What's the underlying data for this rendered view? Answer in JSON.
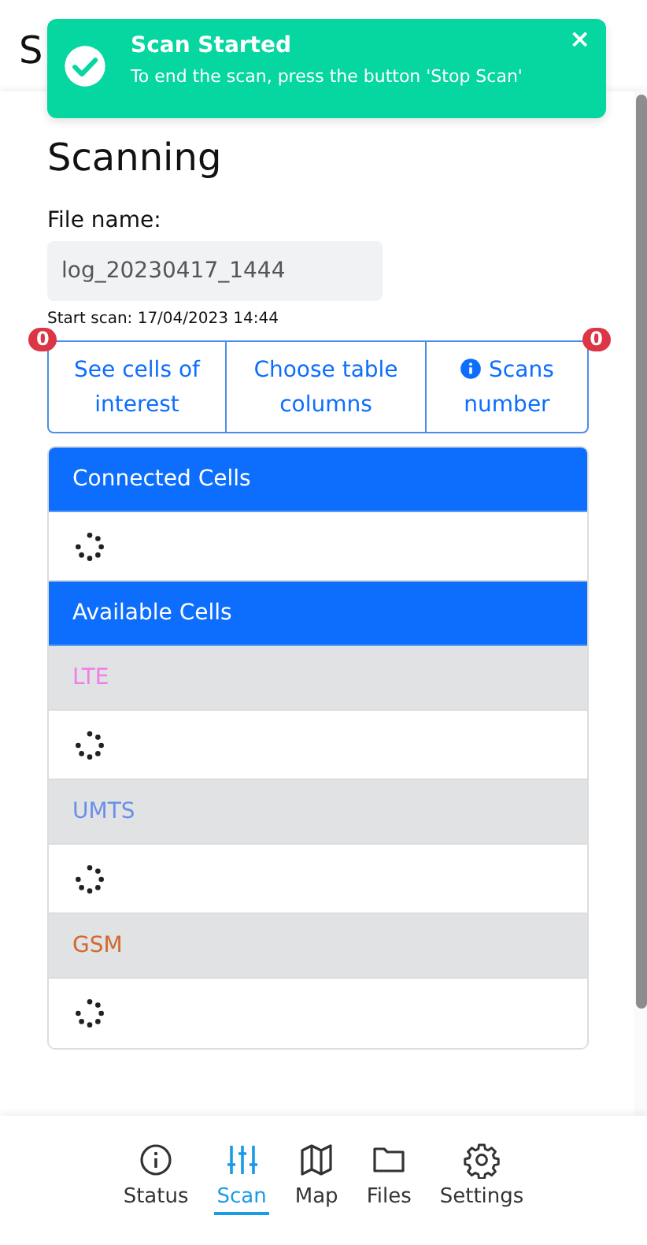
{
  "page_title": "S",
  "toast": {
    "title": "Scan Started",
    "message": "To end the scan, press the button 'Stop Scan'",
    "close": "×"
  },
  "heading": "Scanning",
  "file_name": {
    "label": "File name:",
    "value": "log_20230417_1444"
  },
  "start_scan": "Start scan: 17/04/2023 14:44",
  "buttons": [
    {
      "label": "See cells of interest",
      "badge": "0"
    },
    {
      "label": "Choose table columns"
    },
    {
      "label": "Scans number",
      "kind": "info",
      "badge": "0"
    }
  ],
  "cells": [
    {
      "kind": "group",
      "label": "Connected Cells"
    },
    {
      "kind": "loading"
    },
    {
      "kind": "group",
      "label": "Available Cells"
    },
    {
      "kind": "band",
      "label": "LTE",
      "color": "#f07ee8"
    },
    {
      "kind": "loading"
    },
    {
      "kind": "band",
      "label": "UMTS",
      "color": "#6a8fe8"
    },
    {
      "kind": "loading"
    },
    {
      "kind": "band",
      "label": "GSM",
      "color": "#d2692f"
    },
    {
      "kind": "loading"
    }
  ],
  "nav": [
    {
      "label": "Status",
      "selected": false
    },
    {
      "label": "Scan",
      "selected": true
    },
    {
      "label": "Map",
      "selected": false
    },
    {
      "label": "Files",
      "selected": false
    },
    {
      "label": "Settings",
      "selected": false
    }
  ]
}
